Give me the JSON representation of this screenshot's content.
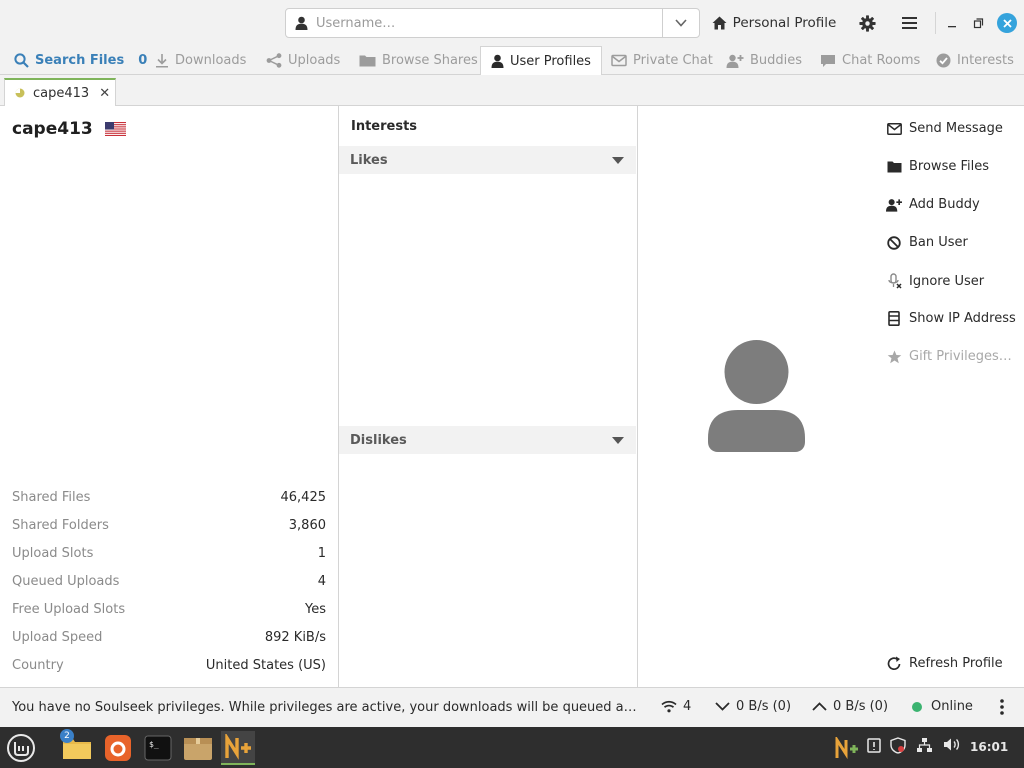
{
  "header": {
    "username_placeholder": "Username…",
    "profile_button": "Personal Profile"
  },
  "tabs": [
    {
      "label": "Search Files",
      "count": "0"
    },
    {
      "label": "Downloads"
    },
    {
      "label": "Uploads"
    },
    {
      "label": "Browse Shares"
    },
    {
      "label": "User Profiles"
    },
    {
      "label": "Private Chat"
    },
    {
      "label": "Buddies"
    },
    {
      "label": "Chat Rooms"
    },
    {
      "label": "Interests"
    }
  ],
  "subtab": {
    "label": "cape413"
  },
  "profile": {
    "username": "cape413",
    "flag": "us-flag",
    "stats": [
      {
        "label": "Shared Files",
        "value": "46,425"
      },
      {
        "label": "Shared Folders",
        "value": "3,860"
      },
      {
        "label": "Upload Slots",
        "value": "1"
      },
      {
        "label": "Queued Uploads",
        "value": "4"
      },
      {
        "label": "Free Upload Slots",
        "value": "Yes"
      },
      {
        "label": "Upload Speed",
        "value": "892 KiB/s"
      },
      {
        "label": "Country",
        "value": "United States (US)"
      }
    ]
  },
  "interests": {
    "title": "Interests",
    "likes": "Likes",
    "dislikes": "Dislikes"
  },
  "actions": [
    {
      "label": "Send Message",
      "icon": "envelope-icon"
    },
    {
      "label": "Browse Files",
      "icon": "folder-icon"
    },
    {
      "label": "Add Buddy",
      "icon": "add-user-icon"
    },
    {
      "label": "Ban User",
      "icon": "ban-icon"
    },
    {
      "label": "Ignore User",
      "icon": "mute-icon"
    },
    {
      "label": "Show IP Address",
      "icon": "server-icon"
    },
    {
      "label": "Gift Privileges…",
      "icon": "star-icon",
      "disabled": true
    }
  ],
  "refresh": "Refresh Profile",
  "status": {
    "message": "You have no Soulseek privileges. While privileges are active, your downloads will be queued ahead of those of non-privileged users.",
    "connections": "4",
    "download_speed": "0 B/s (0)",
    "upload_speed": "0 B/s (0)",
    "online": "Online"
  },
  "taskbar": {
    "files_badge": "2",
    "clock": "16:01"
  },
  "colors": {
    "accent": "#3a80b8",
    "online": "#3bb370",
    "close": "#35a3dc"
  }
}
